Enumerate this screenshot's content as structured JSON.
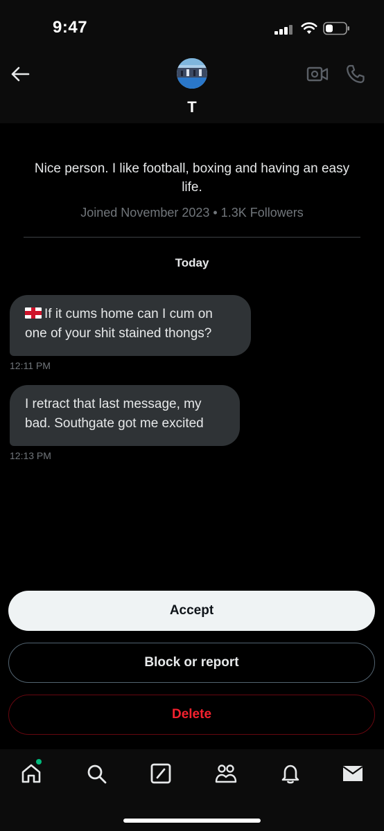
{
  "status_bar": {
    "time": "9:47"
  },
  "conversation": {
    "contact_name": "T",
    "bio": "Nice person. I like football, boxing and having an easy life.",
    "meta": "Joined November 2023 • 1.3K Followers",
    "date_separator": "Today"
  },
  "messages": [
    {
      "text": "If it cums home can I cum on one of your shit stained thongs?",
      "time": "12:11 PM",
      "flag": "england-flag"
    },
    {
      "text": "I retract that last message, my bad. Southgate got me excited",
      "time": "12:13 PM"
    }
  ],
  "actions": {
    "accept": "Accept",
    "block_report": "Block or report",
    "delete": "Delete"
  },
  "tabs": [
    "home-icon",
    "search-icon",
    "grok-icon",
    "communities-icon",
    "notifications-icon",
    "messages-icon"
  ],
  "colors": {
    "accent_delete": "#f4212e",
    "bubble": "#2f3336",
    "unread_dot": "#00ba7c"
  }
}
